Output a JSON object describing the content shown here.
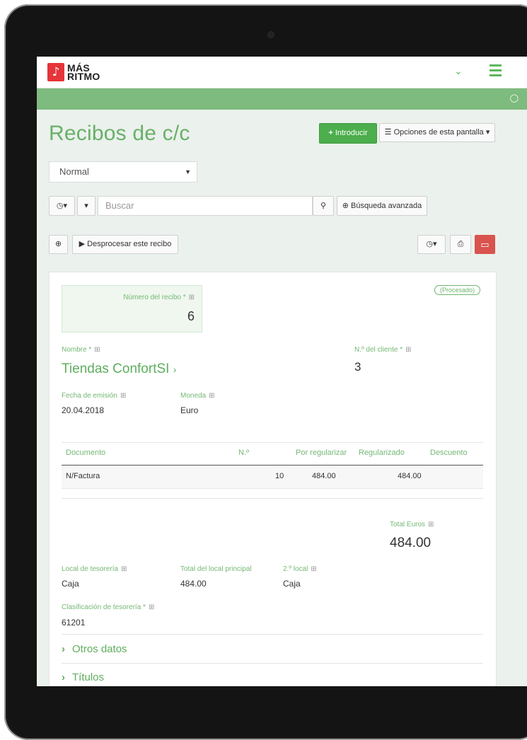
{
  "app": {
    "logo_line1": "MÁS",
    "logo_line2": "RITMO"
  },
  "page": {
    "title": "Recibos de c/c"
  },
  "toolbar": {
    "introduce_label": "Introducir",
    "options_label": "Opciones de esta pantalla"
  },
  "view_select": {
    "value": "Normal"
  },
  "search": {
    "placeholder": "Buscar",
    "advanced_label": "Búsqueda avanzada"
  },
  "actions": {
    "unprocess_label": "Desprocesar este recibo"
  },
  "receipt": {
    "status_badge": "(Procesado)",
    "number_label": "Número del recibo *",
    "number_value": "6",
    "name_label": "Nombre *",
    "name_value": "Tiendas ConfortSI",
    "client_no_label": "N.º del cliente *",
    "client_no_value": "3",
    "issue_date_label": "Fecha de emisión",
    "issue_date_value": "20.04.2018",
    "currency_label": "Moneda",
    "currency_value": "Euro"
  },
  "table": {
    "headers": [
      "Documento",
      "N.º",
      "Por regularizar",
      "Regularizado",
      "Descuento"
    ],
    "rows": [
      {
        "documento": "N/Factura",
        "numero": "10",
        "por_regularizar": "484.00",
        "regularizado": "484.00",
        "descuento": ""
      }
    ]
  },
  "totals": {
    "total_label": "Total Euros",
    "total_value": "484.00"
  },
  "treasury": {
    "local_label": "Local de tesorería",
    "local_value": "Caja",
    "main_total_label": "Total del local principal",
    "main_total_value": "484.00",
    "second_local_label": "2.º local",
    "second_local_value": "Caja",
    "classification_label": "Clasificación de tesorería *",
    "classification_value": "61201"
  },
  "sections": {
    "other_data": "Otros datos",
    "titles": "Títulos"
  },
  "colors": {
    "brand_green": "#5cb85c",
    "logo_red": "#e5343a",
    "delete_red": "#d9534f"
  }
}
